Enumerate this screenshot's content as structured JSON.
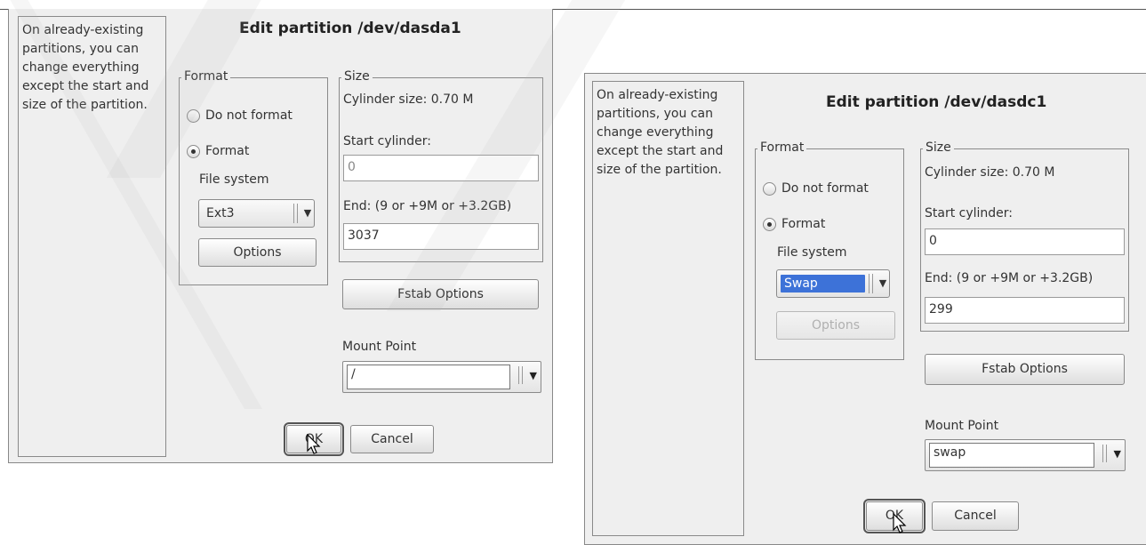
{
  "dialog1": {
    "help_text": "On already-existing partitions, you can change everything except the start and size of the partition.",
    "title": "Edit partition /dev/dasda1",
    "format_group": {
      "legend": "Format",
      "do_not_format": "Do not format",
      "format": "Format",
      "file_system_label": "File system",
      "file_system_value": "Ext3",
      "options_button": "Options"
    },
    "size_group": {
      "legend": "Size",
      "cylinder_size": "Cylinder size: 0.70 M",
      "start_label": "Start cylinder:",
      "start_value": "0",
      "end_label": "End:  (9 or +9M or +3.2GB)",
      "end_value": "3037"
    },
    "fstab_button": "Fstab Options",
    "mount_point_label": "Mount Point",
    "mount_point_value": "/",
    "ok_button": "OK",
    "cancel_button": "Cancel"
  },
  "dialog2": {
    "help_text": "On already-existing partitions, you can change everything except the start and size of the partition.",
    "title": "Edit partition /dev/dasdc1",
    "format_group": {
      "legend": "Format",
      "do_not_format": "Do not format",
      "format": "Format",
      "file_system_label": "File system",
      "file_system_value": "Swap",
      "options_button": "Options"
    },
    "size_group": {
      "legend": "Size",
      "cylinder_size": "Cylinder size: 0.70 M",
      "start_label": "Start cylinder:",
      "start_value": "0",
      "end_label": "End:  (9 or +9M or +3.2GB)",
      "end_value": "299"
    },
    "fstab_button": "Fstab Options",
    "mount_point_label": "Mount Point",
    "mount_point_value": "swap",
    "ok_button": "OK",
    "cancel_button": "Cancel"
  },
  "colors": {
    "dialog_bg": "#efefef",
    "selection": "#3d72d8",
    "watermark": "#ececec"
  }
}
